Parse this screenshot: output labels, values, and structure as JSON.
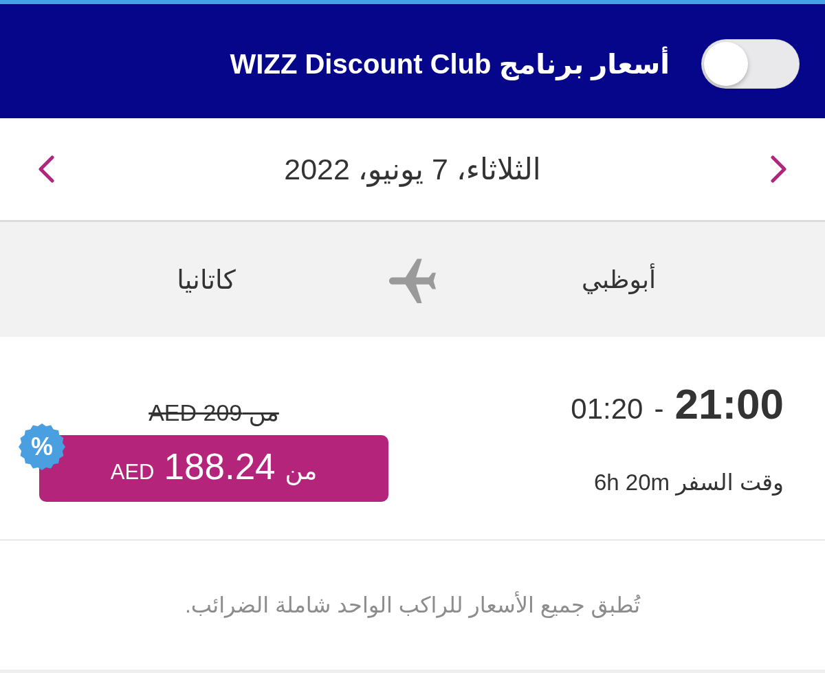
{
  "header": {
    "label": "أسعار برنامج WIZZ Discount Club",
    "toggle": {
      "on": false
    }
  },
  "date_bar": {
    "date": "الثلاثاء، 7 يونيو، 2022"
  },
  "route": {
    "origin": "أبوظبي",
    "destination": "كاتانيا"
  },
  "flight": {
    "departure": "21:00",
    "separator": "-",
    "arrival": "01:20",
    "duration": "وقت السفر 6h 20m",
    "old_price": "من AED 209",
    "price": {
      "prefix": "من",
      "amount": "188.24",
      "currency": "AED"
    },
    "discount_badge": "%"
  },
  "footnote": "تُطبق جميع الأسعار للراكب الواحد شاملة الضرائب."
}
